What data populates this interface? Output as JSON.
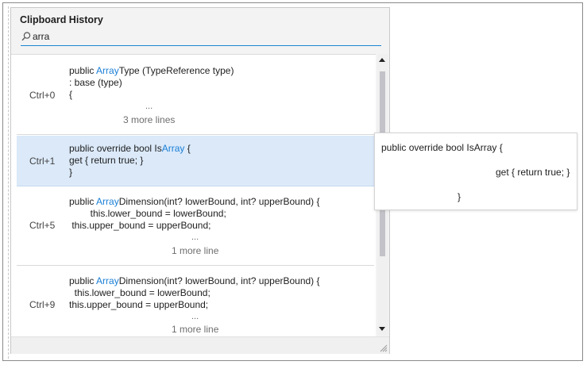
{
  "window": {
    "title": "Clipboard History"
  },
  "search": {
    "value": "arra",
    "icon": "search-icon"
  },
  "items": [
    {
      "shortcut": "Ctrl+0",
      "lines": [
        {
          "pre": "public ",
          "hl": "Array",
          "post": "Type (TypeReference type)"
        },
        {
          "pre": ": base (type)",
          "hl": "",
          "post": ""
        },
        {
          "pre": "{",
          "hl": "",
          "post": ""
        }
      ],
      "ellipsis": "...",
      "more": "3 more lines",
      "selected": false
    },
    {
      "shortcut": "Ctrl+1",
      "lines": [
        {
          "pre": "public override bool Is",
          "hl": "Array",
          "post": " {"
        },
        {
          "pre": "get { return true; }",
          "hl": "",
          "post": ""
        },
        {
          "pre": "}",
          "hl": "",
          "post": ""
        }
      ],
      "ellipsis": "",
      "more": "",
      "selected": true
    },
    {
      "shortcut": "Ctrl+5",
      "lines": [
        {
          "pre": "public ",
          "hl": "Array",
          "post": "Dimension(int? lowerBound, int? upperBound) {"
        },
        {
          "pre": "        this.lower_bound = lowerBound;",
          "hl": "",
          "post": ""
        },
        {
          "pre": " this.upper_bound = upperBound;",
          "hl": "",
          "post": ""
        }
      ],
      "ellipsis": "...",
      "more": "1 more line",
      "selected": false
    },
    {
      "shortcut": "Ctrl+9",
      "lines": [
        {
          "pre": "public ",
          "hl": "Array",
          "post": "Dimension(int? lowerBound, int? upperBound) {"
        },
        {
          "pre": "  this.lower_bound = lowerBound;",
          "hl": "",
          "post": ""
        },
        {
          "pre": "this.upper_bound = upperBound;",
          "hl": "",
          "post": ""
        }
      ],
      "ellipsis": "...",
      "more": "1 more line",
      "selected": false
    }
  ],
  "preview": {
    "line1": "public override bool IsArray {",
    "line2": "get { return true; }",
    "line3": "}"
  },
  "colors": {
    "accent": "#1a86d4",
    "highlight": "#1a7fd6",
    "selected_bg": "#dbe9f9"
  }
}
